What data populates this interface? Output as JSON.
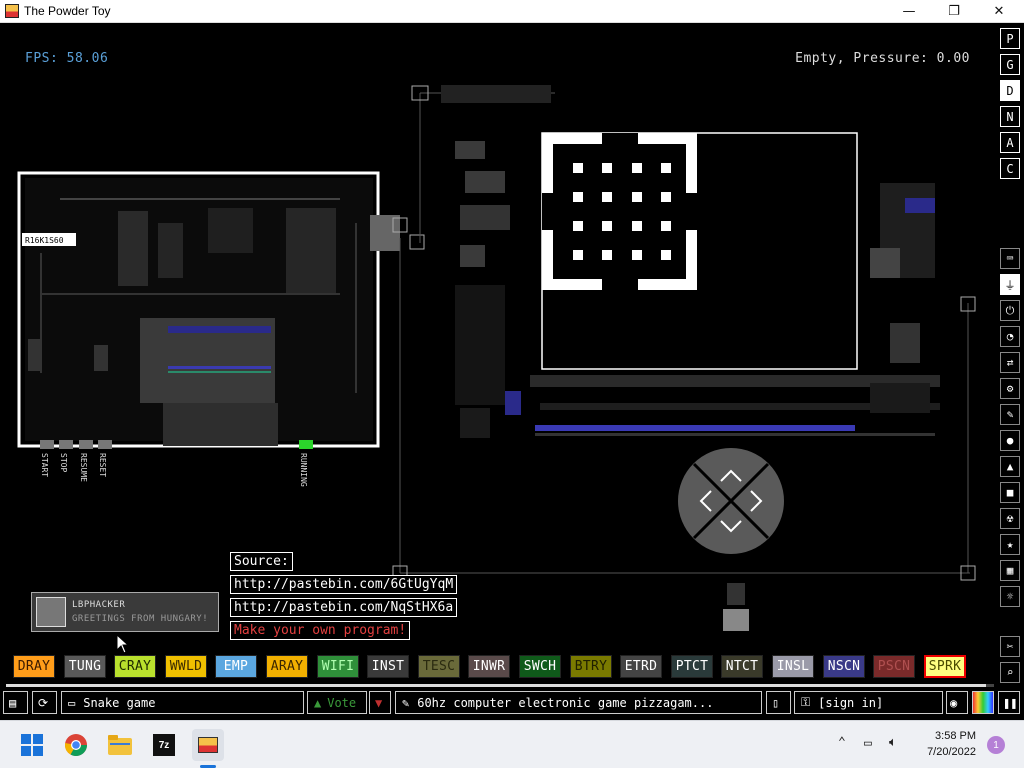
{
  "window": {
    "title": "The Powder Toy",
    "minimize_glyph": "—",
    "maximize_glyph": "❐",
    "close_glyph": "✕"
  },
  "hud": {
    "fps": "FPS: 58.06",
    "status": "Empty, Pressure: 0.00"
  },
  "circuit": {
    "cpu_label": "R16K1S60",
    "controls": [
      "START",
      "STOP",
      "RESUME",
      "RESET"
    ],
    "running_label": "RUNNING"
  },
  "modes": [
    "P",
    "G",
    "D",
    "N",
    "A",
    "C"
  ],
  "active_mode": "D",
  "tools": [
    "keyboard-icon",
    "plug-icon",
    "power-icon",
    "clock-icon",
    "arrows-icon",
    "gear-icon",
    "brush-icon",
    "drop-icon",
    "flask-icon",
    "square-icon",
    "radiation-icon",
    "star-icon",
    "grid-icon",
    "bulb-icon",
    "wrench-icon",
    "magnifier-icon"
  ],
  "source": {
    "heading": "Source:",
    "links": [
      "http://pastebin.com/6GtUgYqM",
      "http://pastebin.com/NqStHX6a"
    ],
    "make_own": "Make your own program!"
  },
  "user": {
    "name": "LBPHACKER",
    "message": "GREETINGS FROM HUNGARY!"
  },
  "elements": [
    {
      "name": "DRAY",
      "bg": "#ff9d1a",
      "fg": "#3a1a00"
    },
    {
      "name": "TUNG",
      "bg": "#595959",
      "fg": "#ffffff"
    },
    {
      "name": "CRAY",
      "bg": "#b9e02d",
      "fg": "#1f2b00"
    },
    {
      "name": "WWLD",
      "bg": "#f0c000",
      "fg": "#3a2a00"
    },
    {
      "name": "EMP",
      "bg": "#5ba7e0",
      "fg": "#ffffff"
    },
    {
      "name": "ARAY",
      "bg": "#f2b000",
      "fg": "#3a2600"
    },
    {
      "name": "WIFI",
      "bg": "#2f8f3a",
      "fg": "#b0ffb0"
    },
    {
      "name": "INST",
      "bg": "#3a3a3a",
      "fg": "#ffffff"
    },
    {
      "name": "TESC",
      "bg": "#6a6a3a",
      "fg": "#2a2a10"
    },
    {
      "name": "INWR",
      "bg": "#5a4a4a",
      "fg": "#ffffff"
    },
    {
      "name": "SWCH",
      "bg": "#0f5a1a",
      "fg": "#ffffff"
    },
    {
      "name": "BTRY",
      "bg": "#7a7a00",
      "fg": "#202000"
    },
    {
      "name": "ETRD",
      "bg": "#444444",
      "fg": "#ffffff"
    },
    {
      "name": "PTCT",
      "bg": "#2a3a3a",
      "fg": "#ffffff"
    },
    {
      "name": "NTCT",
      "bg": "#3a3a2a",
      "fg": "#ffffff"
    },
    {
      "name": "INSL",
      "bg": "#9a9aa8",
      "fg": "#ffffff"
    },
    {
      "name": "NSCN",
      "bg": "#3a3a88",
      "fg": "#ffffff"
    },
    {
      "name": "PSCN",
      "bg": "#7a2a2a",
      "fg": "#b05050"
    },
    {
      "name": "SPRK",
      "bg": "#ffff80",
      "fg": "#4a4a00"
    }
  ],
  "selected_element": "SPRK",
  "bottom_bar": {
    "save_title": "Snake game",
    "vote_label": "Vote",
    "tags": "60hz computer electronic game pizzagam...",
    "sign_in": "[sign in]"
  },
  "taskbar": {
    "apps": [
      "windows-start",
      "chrome",
      "file-explorer",
      "7-zip",
      "powder-toy"
    ],
    "time": "3:58 PM",
    "date": "7/20/2022",
    "notifications": "1"
  }
}
